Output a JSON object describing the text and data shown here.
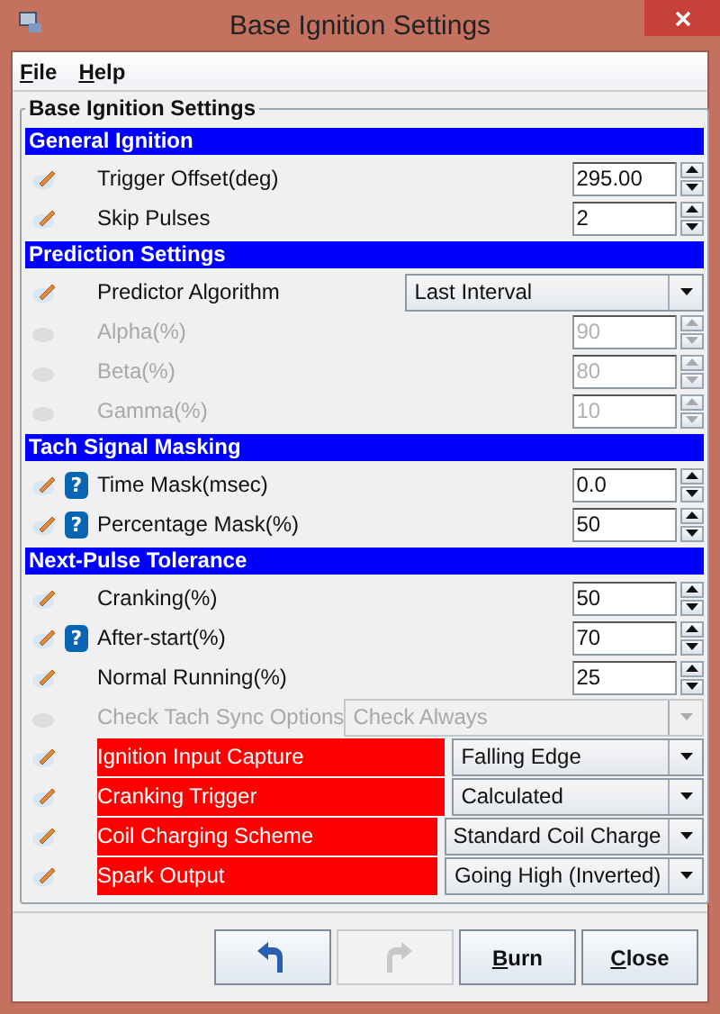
{
  "window": {
    "title": "Base Ignition Settings"
  },
  "menu": [
    {
      "label": "File"
    },
    {
      "label": "Help"
    }
  ],
  "group_title": "Base Ignition Settings",
  "rows": [
    {
      "kind": "header",
      "label": "General Ignition"
    },
    {
      "kind": "spinner",
      "label": "Trigger Offset(deg)",
      "value": "295.00",
      "disabled": false
    },
    {
      "kind": "spinner",
      "label": "Skip Pulses",
      "value": "2",
      "disabled": false
    },
    {
      "kind": "header",
      "label": "Prediction Settings"
    },
    {
      "kind": "combo",
      "label": "Predictor Algorithm",
      "value": "Last Interval",
      "disabled": false
    },
    {
      "kind": "spinner",
      "label": "Alpha(%)",
      "value": "90",
      "disabled": true
    },
    {
      "kind": "spinner",
      "label": "Beta(%)",
      "value": "80",
      "disabled": true
    },
    {
      "kind": "spinner",
      "label": "Gamma(%)",
      "value": "10",
      "disabled": true
    },
    {
      "kind": "header",
      "label": "Tach Signal Masking"
    },
    {
      "kind": "spinner",
      "label": "Time Mask(msec)",
      "value": "0.0",
      "disabled": false,
      "help": "?"
    },
    {
      "kind": "spinner",
      "label": "Percentage Mask(%)",
      "value": "50",
      "disabled": false,
      "help": "?"
    },
    {
      "kind": "header",
      "label": "Next-Pulse Tolerance"
    },
    {
      "kind": "spinner",
      "label": "Cranking(%)",
      "value": "50",
      "disabled": false
    },
    {
      "kind": "spinner",
      "label": "After-start(%)",
      "value": "70",
      "disabled": false,
      "help": "?"
    },
    {
      "kind": "spinner",
      "label": "Normal Running(%)",
      "value": "25",
      "disabled": false
    },
    {
      "kind": "combo",
      "label": "Check Tach Sync Options",
      "value": "Check Always",
      "disabled": true
    },
    {
      "kind": "alert_combo",
      "label": "Ignition Input Capture",
      "value": "Falling Edge",
      "disabled": false
    },
    {
      "kind": "alert_combo",
      "label": "Cranking Trigger",
      "value": "Calculated",
      "disabled": false
    },
    {
      "kind": "alert_combo",
      "label": "Coil Charging Scheme",
      "value": "Standard Coil Charge",
      "disabled": false
    },
    {
      "kind": "alert_combo",
      "label": "Spark Output",
      "value": "Going High (Inverted)",
      "disabled": false
    }
  ],
  "buttons": [
    {
      "kind": "undo",
      "disabled": false
    },
    {
      "kind": "redo",
      "disabled": true
    },
    {
      "kind": "text",
      "label": "Burn",
      "disabled": false
    },
    {
      "kind": "text",
      "label": "Close",
      "disabled": false
    }
  ]
}
